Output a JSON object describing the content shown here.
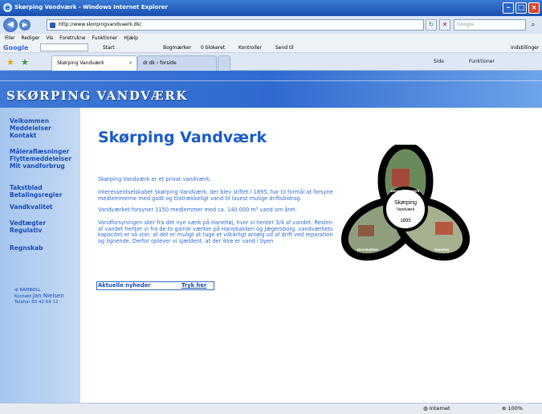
{
  "window": {
    "title": "Skørping Vandværk - Windows Internet Explorer"
  },
  "address": {
    "url": "http://www.skorpingvandvaerk.dk/",
    "search_placeholder": "Google"
  },
  "menu": [
    "Filer",
    "Rediger",
    "Vis",
    "Foretrukne",
    "Funktioner",
    "Hjælp"
  ],
  "google_bar": {
    "logo": "Google",
    "start": "Start",
    "bookmarks": "Bogmærker",
    "blocked": "0 blokeret",
    "check": "Kontroller",
    "send": "Send til",
    "settings": "Indstillinger"
  },
  "tabs": [
    {
      "label": "Skørping Vandværk"
    },
    {
      "label": "dr.dk › forside"
    }
  ],
  "command_bar": {
    "page": "Side",
    "tools": "Funktioner"
  },
  "site": {
    "brand": "SKØRPING VANDVÆRK",
    "nav_groups": [
      [
        "Velkommen",
        "Meddelelser",
        "Kontakt"
      ],
      [
        "Måleraflæsninger",
        "Flyttemeddelelser",
        "Mit vandforbrug"
      ],
      [
        "Takstblad",
        "Betalingsregler"
      ],
      [
        "Vandkvalitet"
      ],
      [
        "Vedtægter",
        "Regulativ"
      ],
      [
        "Regnskab"
      ]
    ],
    "contact": {
      "company": "RAMBØLL",
      "kontakt_label": "Kontakt",
      "name": "Jan Nielsen",
      "phone": "Telefon 65 42 69 12"
    }
  },
  "content": {
    "heading": "Skørping Vandværk",
    "p1": "Skørping Vandværk er et privat vandværk.",
    "p2": "Interessentselskabet Skørping Vandværk, der blev stiftet i 1895, har til formål at forsyne medlemmerne med godt og tilstrækkeligt vand til lavest mulige driftsbidrag.",
    "p3": "Vandværket forsyner 1150 medlemmer med ca. 140.000 m³ vand om året.",
    "p4": "Vandforsyningen sker fra det nye værk på Hanehøj, hvor vi henter 3/4 af vandet. Resten af vandet henter vi fra de to gamle værker på Hanebakken og Jægersborg. vandværkets kapacitet er så stor, at det er muligt at tage et vilkårligt anlæg ud af drift ved reparation og lignende. Derfor oplever vi sjældent, at der ikke er vand i byen",
    "news_label": "Aktuelle nyheder",
    "news_link": "Tryk her"
  },
  "logo": {
    "center_name": "Skørping",
    "center_sub": "Vandværk",
    "year": "1895",
    "label_top": "Jægersborgværk",
    "label_left": "Hanebakken",
    "label_right": "Hanehøj"
  },
  "status": {
    "zone": "Internet",
    "zoom": "100%"
  },
  "colors": {
    "accent": "#1a5bc8",
    "banner": "#2f6ad0",
    "sidebar": "#b5cff2"
  }
}
